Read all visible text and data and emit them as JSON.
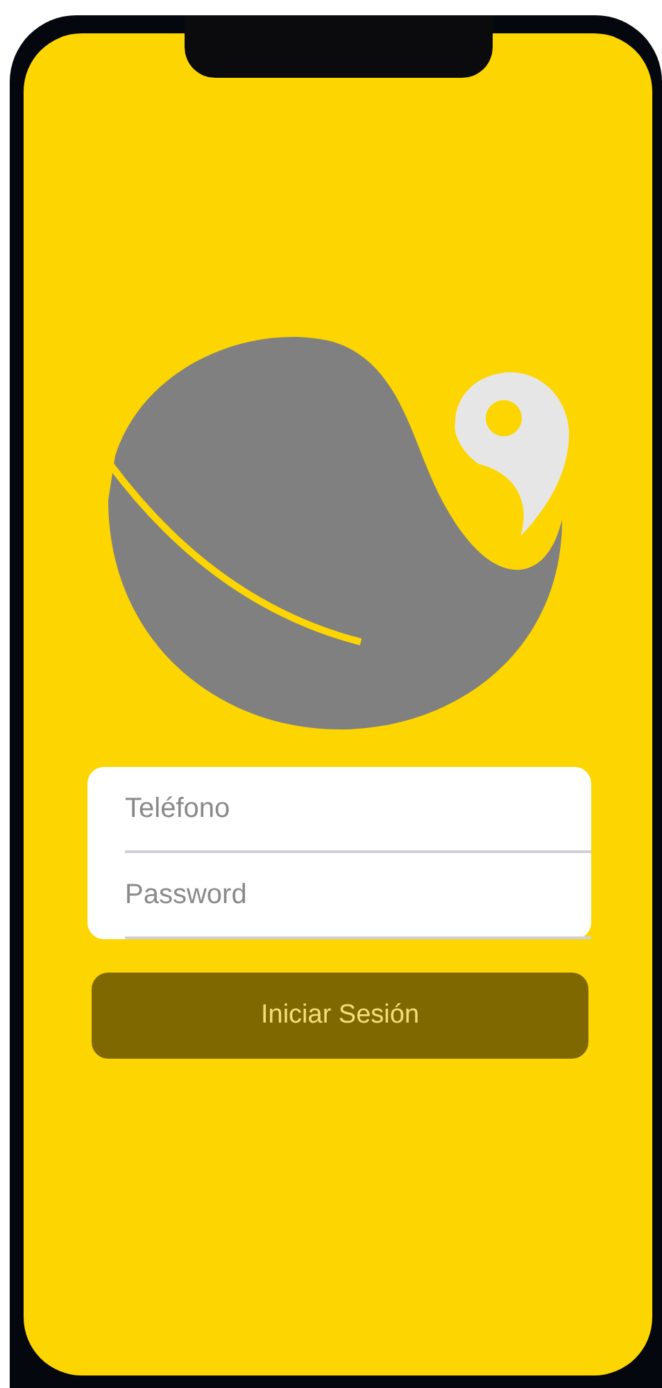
{
  "login_form": {
    "fields": [
      {
        "placeholder": "Teléfono"
      },
      {
        "placeholder": "Password"
      }
    ]
  },
  "submit_button": {
    "label": "Iniciar Sesión"
  }
}
